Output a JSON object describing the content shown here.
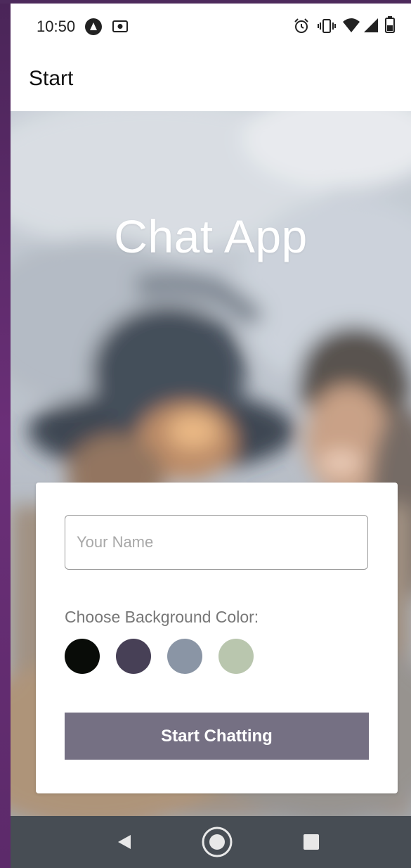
{
  "status_bar": {
    "time": "10:50",
    "icons": [
      "app-notification-icon",
      "screenshot-icon",
      "alarm-icon",
      "vibrate-icon",
      "wifi-icon",
      "signal-icon",
      "battery-icon"
    ]
  },
  "app_bar": {
    "title": "Start"
  },
  "main": {
    "title": "Chat App"
  },
  "form": {
    "name_placeholder": "Your Name",
    "name_value": "",
    "color_label": "Choose Background Color:",
    "colors": [
      "#090C08",
      "#474056",
      "#8A95A5",
      "#B9C6AE"
    ],
    "start_button_label": "Start Chatting"
  },
  "nav_bar": {
    "buttons": [
      "back-icon",
      "home-icon",
      "recents-icon"
    ]
  },
  "theme": {
    "button_color": "#757083",
    "nav_bar_color": "#474D54"
  }
}
